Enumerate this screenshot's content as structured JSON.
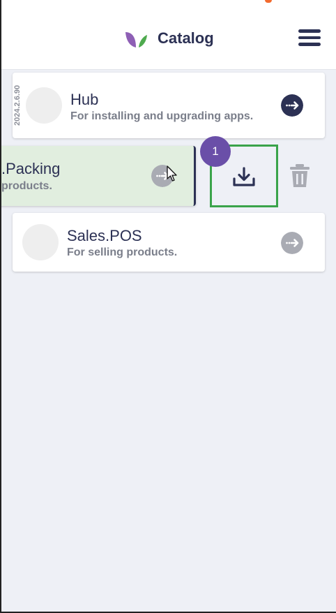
{
  "header": {
    "title": "Catalog",
    "accent_color": "#f26a2e",
    "logo_icon": "leaf-logo-icon",
    "menu_icon": "hamburger-menu-icon"
  },
  "apps": [
    {
      "name": "Hub",
      "description": "For installing and upgrading apps.",
      "version": "2024.2.6.90",
      "arrow_color": "#2c3154"
    },
    {
      "name": ".Packing",
      "description": "products.",
      "state": "swiped",
      "arrow_color": "#a9abb3"
    },
    {
      "name": "Sales.POS",
      "description": "For selling products.",
      "arrow_color": "#a9abb3"
    }
  ],
  "swipe_actions": {
    "install_icon": "download-icon",
    "delete_icon": "trash-icon",
    "step_badge": "1",
    "highlight_color": "#3aa34a",
    "badge_color": "#6a4fa8"
  },
  "colors": {
    "primary": "#2c3154",
    "background": "#eef0f6",
    "swiped_card_bg": "#e1eedf"
  }
}
